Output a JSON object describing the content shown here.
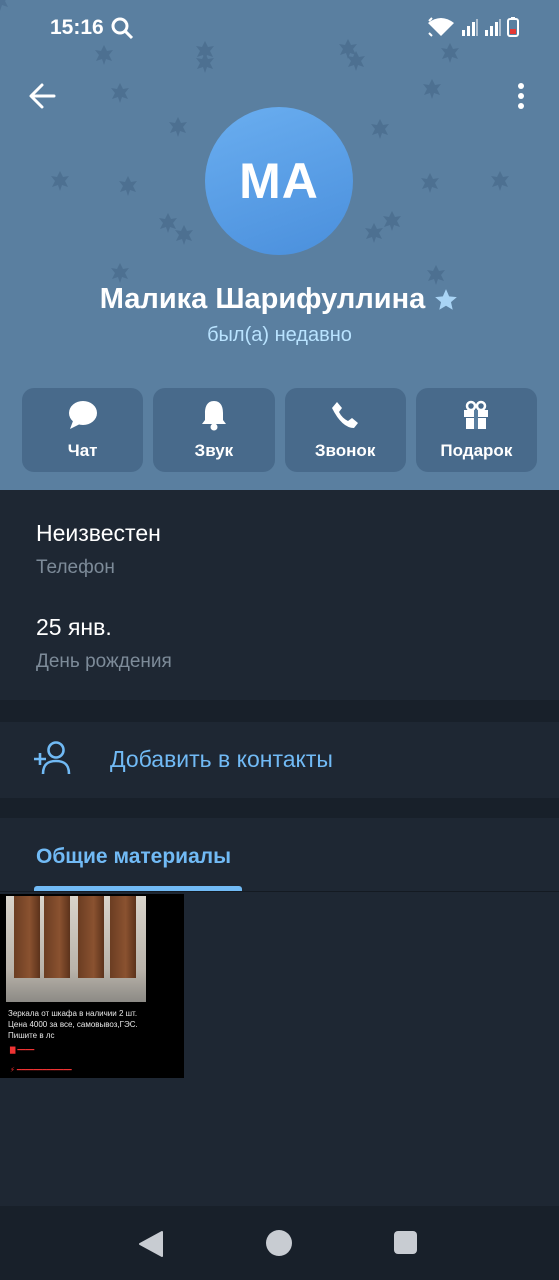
{
  "status_bar": {
    "time": "15:16",
    "icons": [
      "search-icon",
      "wifi-icon",
      "signal-icon",
      "signal-icon",
      "battery-icon"
    ]
  },
  "header": {
    "avatar_initials": "МА",
    "name": "Малика Шарифуллина",
    "status": "был(а) недавно",
    "colors": {
      "background": "#5a7fa0",
      "avatar": "#4a8fdc",
      "status_text": "#b9e3ff"
    }
  },
  "actions": [
    {
      "label": "Чат",
      "icon": "chat-bubble-icon"
    },
    {
      "label": "Звук",
      "icon": "bell-icon"
    },
    {
      "label": "Звонок",
      "icon": "phone-icon"
    },
    {
      "label": "Подарок",
      "icon": "gift-icon"
    }
  ],
  "info": {
    "phone_value": "Неизвестен",
    "phone_label": "Телефон",
    "birthday_value": "25 янв.",
    "birthday_label": "День рождения"
  },
  "add_contact": {
    "label": "Добавить в контакты",
    "icon": "add-person-icon"
  },
  "media": {
    "tab_label": "Общие материалы",
    "thumb_text": "Зеркала от шкафа в наличии 2 шт. Цена 4000 за все, самовывоз,ГЭС. Пишите в лс",
    "accent": "#71baf5"
  },
  "nav_bar": {
    "icons": [
      "nav-back-icon",
      "nav-home-icon",
      "nav-recent-icon"
    ]
  }
}
